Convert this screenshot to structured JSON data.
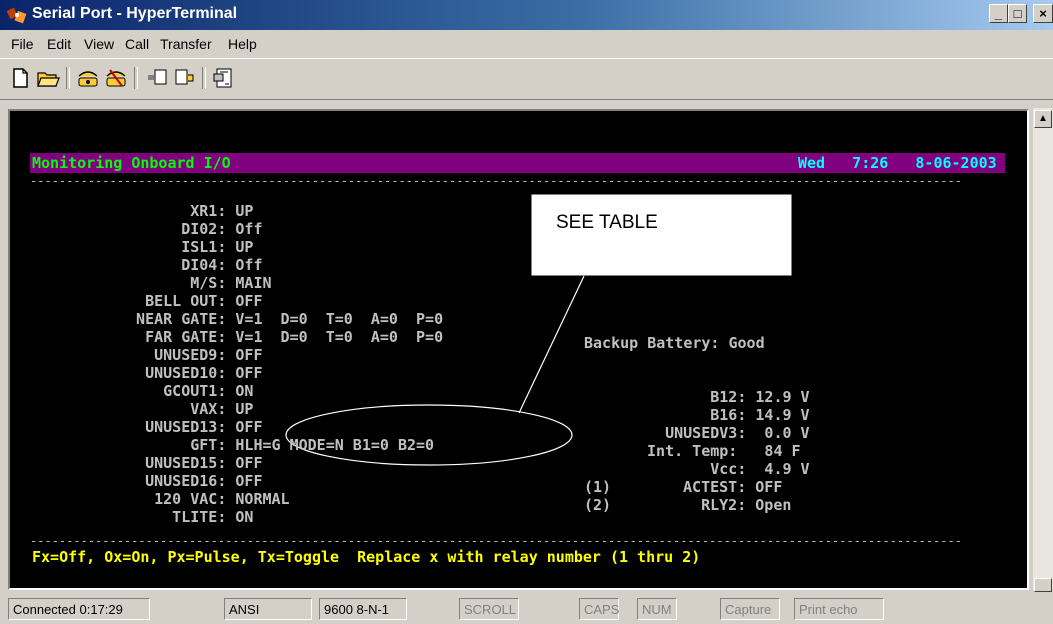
{
  "window": {
    "title": "Serial Port - HyperTerminal",
    "controls": {
      "minimize": "_",
      "maximize": "□",
      "close": "×"
    }
  },
  "menu": [
    "File",
    "Edit",
    "View",
    "Call",
    "Transfer",
    "Help"
  ],
  "toolbar": {
    "buttons": [
      "new-icon",
      "open-icon",
      "connect-icon",
      "disconnect-icon",
      "send-icon",
      "receive-icon",
      "properties-icon"
    ]
  },
  "terminal": {
    "header_left": "Monitoring Onboard I/O",
    "header_right": "Wed   7:26   8-06-2003",
    "separator": "---------------------------------------------------------------------------------------------------------------------------------",
    "left_rows": [
      "        XR1: UP",
      "       DI02: Off",
      "       ISL1: UP",
      "       DI04: Off",
      "        M/S: MAIN",
      "   BELL OUT: OFF",
      "  NEAR GATE: V=1  D=0  T=0  A=0  P=0",
      "   FAR GATE: V=1  D=0  T=0  A=0  P=0",
      "    UNUSED9: OFF",
      "   UNUSED10: OFF",
      "     GCOUT1: ON",
      "        VAX: UP",
      "   UNUSED13: OFF",
      "        GFT: HLH=G MODE=N B1=0 B2=0",
      "   UNUSED15: OFF",
      "   UNUSED16: OFF",
      "    120 VAC: NORMAL",
      "      TLITE: ON"
    ],
    "backup_battery": "Backup Battery: Good",
    "right_rows": [
      "        B12: 12.9 V",
      "        B16: 14.9 V",
      "   UNUSEDV3:  0.0 V",
      " Int. Temp:   84 F",
      "        Vcc:  4.9 V"
    ],
    "relays": [
      {
        "num": "(1)",
        "text": " ACTEST: OFF"
      },
      {
        "num": "(2)",
        "text": "   RLY2: Open"
      }
    ],
    "footer": "Fx=Off, Ox=On, Px=Pulse, Tx=Toggle  Replace x with relay number (1 thru 2)",
    "callout": "SEE TABLE"
  },
  "status": {
    "connected": "Connected 0:17:29",
    "emulation": "ANSI",
    "settings": "9600 8-N-1",
    "scroll": "SCROLL",
    "caps": "CAPS",
    "num": "NUM",
    "capture": "Capture",
    "print_echo": "Print echo"
  },
  "colors": {
    "title_gradient_start": "#0a246a",
    "header_bg": "#800080",
    "header_fg": "#00ff00",
    "terminal_fg": "#c0c0c0",
    "footer_fg": "#ffff00",
    "header_right_fg": "#00ffff"
  }
}
